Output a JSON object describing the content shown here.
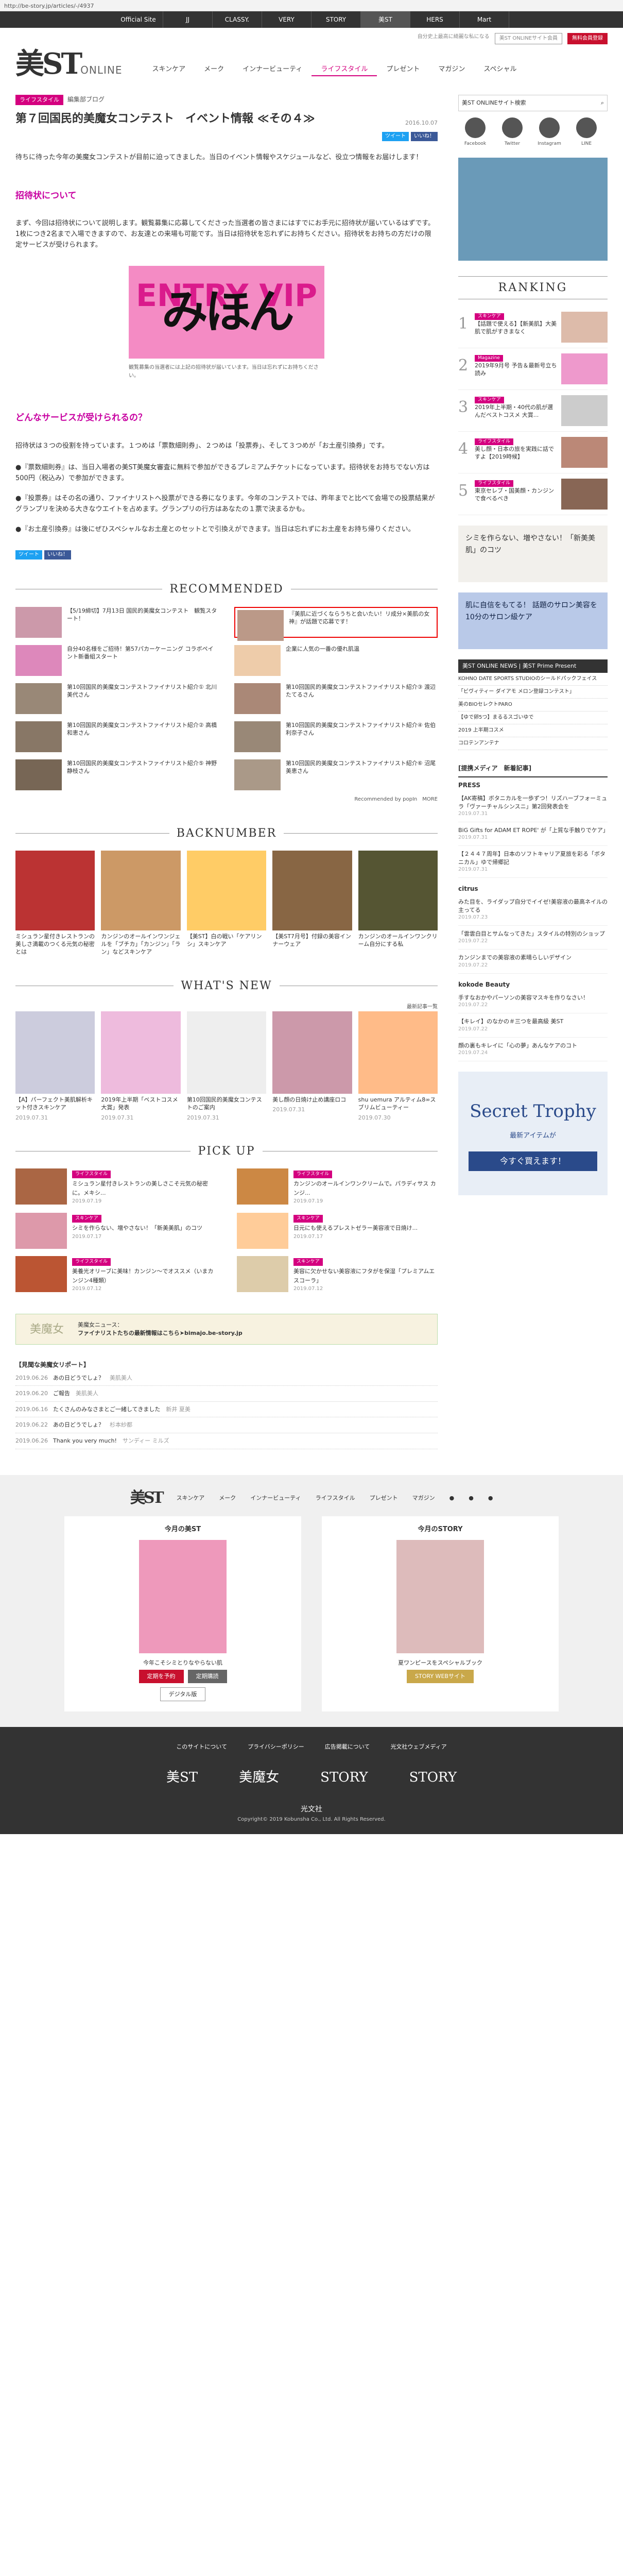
{
  "url": "http://be-story.jp/articles/-/4937",
  "topnav": [
    "Official Site",
    "JJ",
    "CLASSY.",
    "VERY",
    "STORY",
    "美ST",
    "HERS",
    "Mart"
  ],
  "header": {
    "logo": "美ST",
    "logo_sub": "ONLINE",
    "tagline": "自分史上最高に綺麗な私になる",
    "nav": [
      "スキンケア",
      "メーク",
      "インナービューティ",
      "ライフスタイル",
      "プレゼント",
      "マガジン",
      "スペシャル"
    ],
    "btn_login": "美ST ONLINEサイト会員",
    "btn_reg": "無料会員登録"
  },
  "article": {
    "tag": "ライフスタイル",
    "blog": "編集部ブログ",
    "title": "第７回国民的美魔女コンテスト　イベント情報 ≪その４≫",
    "date": "2016.10.07",
    "share_tw": "ツイート",
    "share_fb": "いいね！",
    "p1": "待ちに待った今年の美魔女コンテストが目前に迫ってきました。当日のイベント情報やスケジュールなど、役立つ情報をお届けします！",
    "h1": "招待状について",
    "p2": "まず、今回は招待状について説明します。観覧募集に応募してくださった当選者の皆さまにはすでにお手元に招待状が届いているはずです。1枚につき2名まで入場できますので、お友達との来場も可能です。当日は招待状を忘れずにお持ちください。招待状をお持ちの方だけの限定サービスが受けられます。",
    "img_text": "みほん",
    "img_sub": "ENTRY VIP",
    "caption": "観覧募集の当選者には上記の招待状が届いています。当日は忘れずにお持ちください。",
    "h2": "どんなサービスが受けられるの？",
    "p3": "招待状は３つの役割を持っています。１つめは「票数細則券」、２つめは「投票券」、そして３つめが「お土産引換券」です。",
    "b1": "●『票数細則券』は、当日入場者の美ST美魔女審査に無料で参加ができるプレミアムチケットになっています。招待状をお持ちでない方は500円（税込み）で参加ができます。",
    "b2": "●『投票券』はその名の通り、ファイナリストへ投票ができる券になります。今年のコンテストでは、昨年までと比べて会場での投票結果がグランプリを決める大きなウエイトを占めます。グランプリの行方はあなたの１票で決まるかも。",
    "b3": "●『お土産引換券』は後にぜひスペシャルなお土産とのセットとで引換えができます。当日は忘れずにお土産をお持ち帰りください。"
  },
  "recommended": {
    "title": "RECOMMENDED",
    "items": [
      "【5/19締切】7月13日 国民的美魔女コンテスト　観覧スタート！",
      "『美肌に近づくならうちと会いたい！リ成分×美肌の女神』が話題で応募です！",
      "自分40名様をご招待！第57パカーケーニング コラボペイント新番組スタート",
      "企業に人気の一番の優れ肌温",
      "第10回国民的美魔女コンテストファイナリスト紹介① 北川美代さん",
      "第10回国民的美魔女コンテストファイナリスト紹介③ 渡辺たてるさん",
      "第10回国民的美魔女コンテストファイナリスト紹介② 高橋和恵さん",
      "第10回国民的美魔女コンテストファイナリスト紹介④ 佐伯利奈子さん",
      "第10回国民的美魔女コンテストファイナリスト紹介⑤ 神野静枝さん",
      "第10回国民的美魔女コンテストファイナリスト紹介⑥ 沼尾美恵さん"
    ],
    "footer": "Recommended by popIn",
    "more": "MORE"
  },
  "backnumber": {
    "title": "BACKNUMBER",
    "items": [
      "ミシュラン星付きレストランの美しさ満載のつくる元気の秘密とは",
      "カンジンのオールインワンジェルを「ブチカ」「カンジン」「ラン」などスキンケア",
      "【美ST】白の戦い「ケアリンシ」スキンケア",
      "【美ST7月号】付録の美容インナーウェア",
      "カンジンのオールインワンクリーム自分にする私"
    ]
  },
  "whatsnew": {
    "title": "WHAT'S NEW",
    "more": "最新記事一覧",
    "items": [
      {
        "t": "【A】パーフェクト美肌解析キット付きスキンケア",
        "d": "2019.07.31"
      },
      {
        "t": "2019年上半期「ベストコスメ大賞」発表",
        "d": "2019.07.31"
      },
      {
        "t": "第10回国民的美魔女コンテストのご案内",
        "d": "2019.07.31"
      },
      {
        "t": "美し顔の日焼け止め講座ロコ",
        "d": "2019.07.31"
      },
      {
        "t": "shu uemura アルティム8∞スブリムビューティー",
        "d": "2019.07.30"
      }
    ]
  },
  "pickup": {
    "title": "PICK UP",
    "items": [
      {
        "c": "ライフスタイル",
        "t": "ミシュラン星付きレストランの美しさこそ元気の秘密に。メキシ...",
        "d": "2019.07.19"
      },
      {
        "c": "ライフスタイル",
        "t": "カンジンのオールインワンクリームで。パラディサス カンジ...",
        "d": "2019.07.19"
      },
      {
        "c": "スキンケア",
        "t": "シミを作らない、増やさない！「新美美肌」のコツ",
        "d": "2019.07.17"
      },
      {
        "c": "スキンケア",
        "t": "日元にも使えるプレストゼラー美容液で日焼け...",
        "d": "2019.07.17"
      },
      {
        "c": "ライフスタイル",
        "t": "美養光オリーブに美味！カンジン〜でオススメ（いまカンジン4種類）",
        "d": "2019.07.12"
      },
      {
        "c": "スキンケア",
        "t": "美容に欠かせない美容液にフタがを保湿「プレミアムエスコーラ」",
        "d": "2019.07.12"
      }
    ]
  },
  "banner": {
    "logo": "美魔女",
    "text1": "美魔女ニュース：",
    "text2": "ファイナリストたちの最新情報はこちら➤bimajo.be-story.jp"
  },
  "report": {
    "title": "【見聞な美魔女リポート】",
    "items": [
      {
        "d": "2019.06.26",
        "t": "あの日どうでしょ？",
        "a": "美肌美人"
      },
      {
        "d": "2019.06.20",
        "t": "ご報告",
        "a": "美肌美人"
      },
      {
        "d": "2019.06.16",
        "t": "たくさんのみなさまとご一緒してきました",
        "a": "新井 夏美"
      },
      {
        "d": "2019.06.22",
        "t": "あの日どうでしょ？",
        "a": "杉本紗都"
      },
      {
        "d": "2019.06.26",
        "t": "Thank you very much!",
        "a": "サンディー ミルズ"
      }
    ]
  },
  "side": {
    "search": "美ST ONLINEサイト検索",
    "social": [
      "Facebook",
      "Twitter",
      "Instagram",
      "LINE"
    ],
    "ranking_title": "RANKING",
    "ranking": [
      {
        "n": "1",
        "c": "スキンケア",
        "t": "【話題で使える】【新美肌】大美肌で肌がすきまなく"
      },
      {
        "n": "2",
        "c": "Magazine",
        "t": "2019年9月号 予告＆最新号立ち読み"
      },
      {
        "n": "3",
        "c": "スキンケア",
        "t": "2019年上半期・40代の肌が選んだベストコスメ 大賞..."
      },
      {
        "n": "4",
        "c": "ライフスタイル",
        "t": "美し顔・日本の旅を実践に話ですよ【2019時候】"
      },
      {
        "n": "5",
        "c": "ライフスタイル",
        "t": "東京セレブ・国美顔・カンジンで食べるべき"
      }
    ],
    "ad1": "シミを作らない、増やさない！「新美美肌」のコツ",
    "ad2": "肌に自信をもてる！ 話題のサロン美容を10分のサロン級ケア",
    "news_title": "美ST ONLINE NEWS | 美ST Prime Present",
    "news": [
      "KOHNO DATE SPORTS STUDIOのシールドパックフェイス",
      "「ビヴィティー ダイアモ メロン登録コンテスト」",
      "美のBIOセレクトPARO",
      "【ゆで卵5つ】まるるスゴいゆで",
      "2019 上半期コスメ",
      "コロテンアンテナ"
    ],
    "pm_title": "[提携メディア　新着記事]",
    "press": "PRESS",
    "press_items": [
      {
        "t": "【AK寄稿】ボタニカルを一歩ずつ！リズハーブフォーミュラ「ヴァーチャルシンスニ」第2回発表会を",
        "d": "2019.07.31"
      },
      {
        "t": "BiG Gifts for ADAM ET ROPE' が「上質な手触りでケア」",
        "d": "2019.07.31"
      },
      {
        "t": "【２４４７周年】日本のソフトキャリア夏旅を彩る「ボタニカル」ゆで帰郷記",
        "d": "2019.07.31"
      }
    ],
    "citrus": "citrus",
    "citrus_items": [
      {
        "t": "みた目を、ライダップ自分でイイゼ!美容液の最高ネイルの主ってる",
        "d": "2019.07.23"
      },
      {
        "t": "「雲雲白目とサムなってきた」スタイルの特別のショップ",
        "d": "2019.07.22"
      },
      {
        "t": "カンジンまでの美容液の素晴らしいデザイン",
        "d": "2019.07.22"
      }
    ],
    "kokode": "kokode Beauty",
    "kokode_items": [
      {
        "t": "手すなおかやパーソンの美容マスキを作りなさい！",
        "d": "2019.07.22"
      },
      {
        "t": "【キレイ】のなかの＃三つを最高級 美ST",
        "d": "2019.07.22"
      },
      {
        "t": "顔の裏もキレイに「心の夢」あんなケアのコト",
        "d": "2019.07.24"
      }
    ],
    "story_title": "Secret Trophy",
    "story_sub": "最新アイテムが",
    "story_btn": "今すぐ買えます！"
  },
  "footer": {
    "nav": [
      "スキンケア",
      "メーク",
      "インナービューティ",
      "ライフスタイル",
      "プレゼント",
      "マガジン"
    ],
    "mag1": "今月の美ST",
    "mag2": "今月のSTORY",
    "mag1_text": "今年こそシミとりなやらない肌",
    "mag1_btn1": "定期を予約",
    "mag1_btn2": "定期購読",
    "mag1_btn3": "デジタル版",
    "mag2_text": "夏ワンピースをスペシャルブック",
    "mag2_btn": "STORY WEBサイト"
  },
  "bottom": {
    "links": [
      "このサイトについて",
      "プライバシーポリシー",
      "広告掲載について",
      "光文社ウェブメディア"
    ],
    "logos": [
      "美ST",
      "美魔女",
      "STORY",
      "STORY"
    ],
    "company": "光文社",
    "copy": "Copyright© 2019 Kobunsha Co., Ltd. All Rights Reserved."
  }
}
